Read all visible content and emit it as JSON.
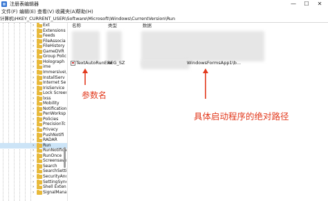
{
  "window": {
    "title": "注册表编辑器",
    "controls": {
      "minimize": "—",
      "maximize": "☐",
      "close": "✕"
    }
  },
  "menu": [
    "文件(F)",
    "编辑(E)",
    "查看(V)",
    "收藏夹(A)",
    "帮助(H)"
  ],
  "address": "计算机\\HKEY_CURRENT_USER\\Software\\Microsoft\\Windows\\CurrentVersion\\Run",
  "tree": {
    "items": [
      "Ext",
      "Extensions",
      "Feeds",
      "FileAssocia",
      "FileHistory",
      "GameDVR",
      "Group Polic",
      "Holograph",
      "ime",
      "Immersive\\",
      "InstallServ",
      "Internet Se",
      "IrisService",
      "Lock Screen",
      "lxss",
      "Mobility",
      "Notification",
      "PenWorksp",
      "Policies",
      "PrecisionTc",
      "Privacy",
      "PushNotifi",
      "RADAR",
      "Run",
      "RunNotificat",
      "RunOnce",
      "Screensave",
      "Search",
      "SearchSetti",
      "SecurityAnd",
      "SettingSync",
      "Shell Exten",
      "SignalMana"
    ],
    "selected": "Run"
  },
  "columns": {
    "name": "名称",
    "type": "类型",
    "data": "数据"
  },
  "values": [
    {
      "name": "TextAutoRunExe",
      "type": "REG_SZ",
      "data": "WindowsFormsApp1\\b..."
    }
  ],
  "annotations": {
    "param_name": "参数名",
    "exe_path": "具体启动程序的绝对路径"
  },
  "colors": {
    "annotation": "#e23a1e",
    "selection": "#cce4f7",
    "folder": "#e8b93a"
  }
}
